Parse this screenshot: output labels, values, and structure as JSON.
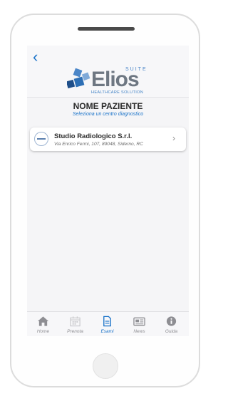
{
  "header": {
    "back_glyph": "‹",
    "logo": {
      "word": "Elios",
      "suite": "SUITE",
      "tagline": "HEALTHCARE SOLUTION"
    }
  },
  "patient": {
    "name": "NOME PAZIENTE",
    "subtitle": "Seleziona un centro diagnostico"
  },
  "centers": [
    {
      "name": "Studio Radiologico S.r.l.",
      "address": "Via Enrico Fermi, 107, 89048, Siderno, RC",
      "chevron": "›"
    }
  ],
  "tabbar": {
    "tabs": [
      {
        "label": "Home",
        "icon": "home-icon"
      },
      {
        "label": "Prenota",
        "icon": "calendar-icon"
      },
      {
        "label": "Esami",
        "icon": "document-icon",
        "active": true
      },
      {
        "label": "News",
        "icon": "newspaper-icon"
      },
      {
        "label": "Guida",
        "icon": "info-icon"
      }
    ]
  },
  "colors": {
    "accent": "#1a73c9",
    "inactive": "#8e8e93",
    "logo_gray": "#6e7782"
  }
}
